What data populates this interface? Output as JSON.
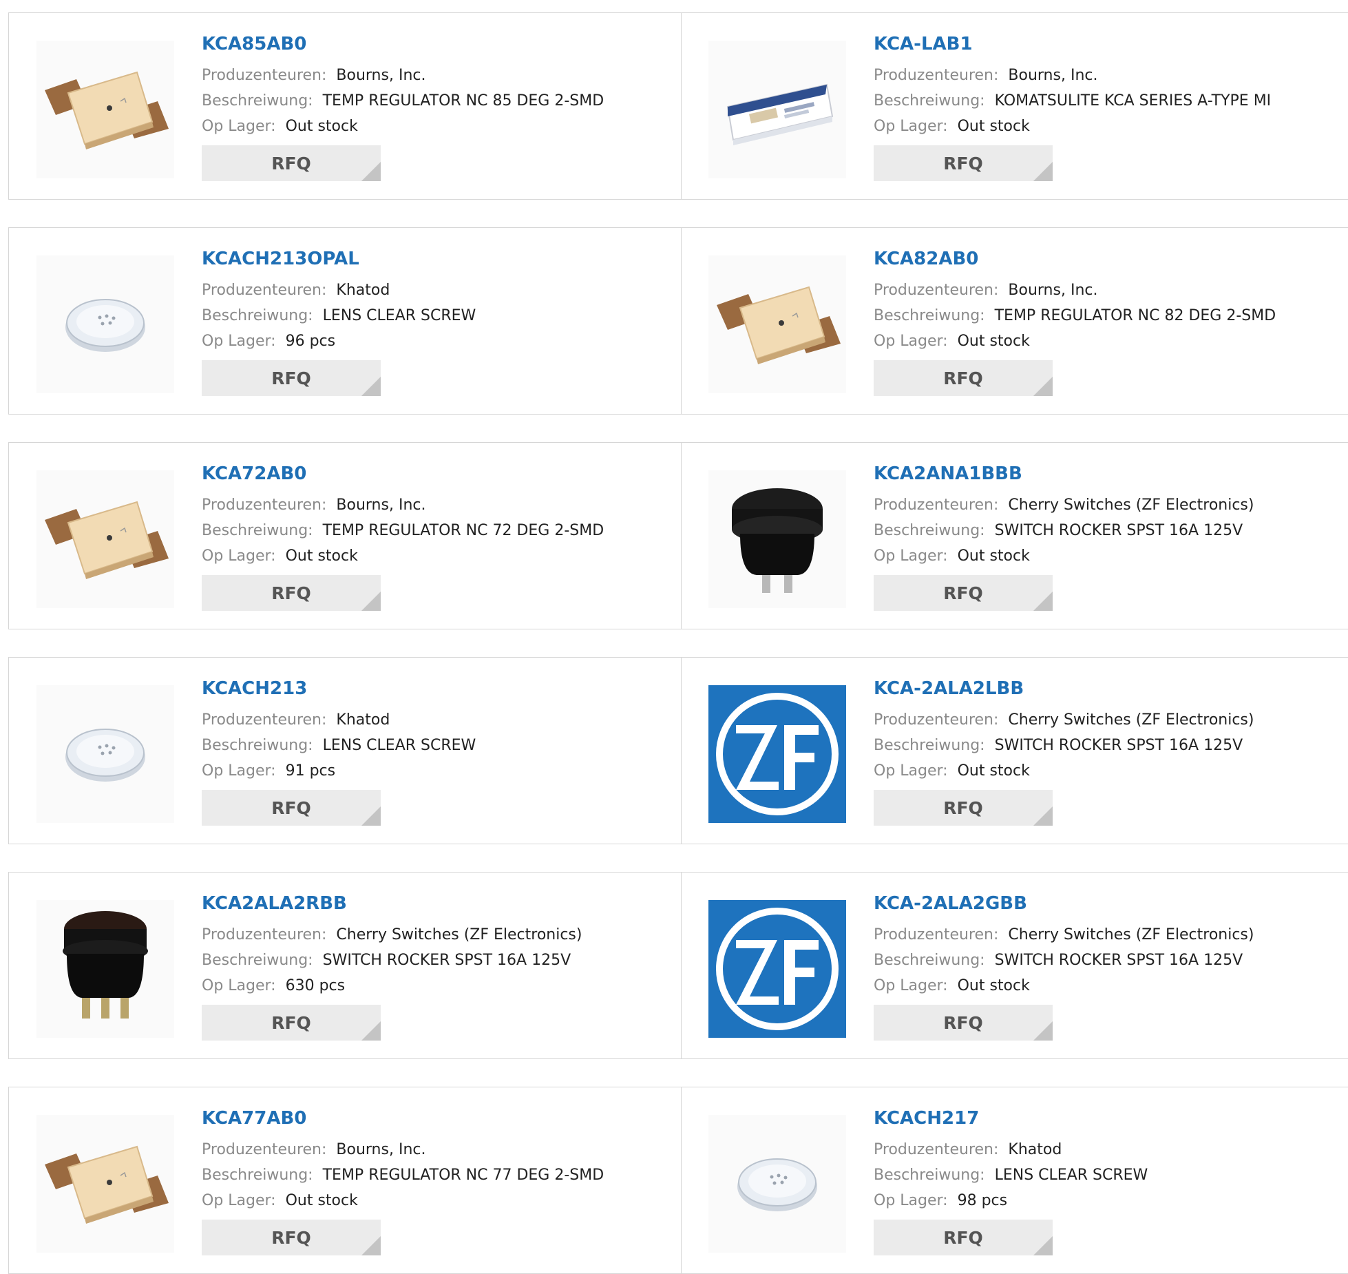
{
  "labels": {
    "manufacturer": "Produzenteuren:",
    "description": "Beschreiwung:",
    "stock": "Op Lager:",
    "rfq": "RFQ"
  },
  "colors": {
    "part_link": "#1f6fb5",
    "label": "#8a8a8a",
    "button_bg": "#ebebeb",
    "zf_blue": "#1e73be"
  },
  "products": [
    {
      "part": "KCA85AB0",
      "manufacturer": "Bourns, Inc.",
      "description": "TEMP REGULATOR NC 85 DEG 2-SMD",
      "stock": "Out stock",
      "image": "temp-regulator-image"
    },
    {
      "part": "KCA-LAB1",
      "manufacturer": "Bourns, Inc.",
      "description": "KOMATSULITE KCA SERIES A-TYPE MI",
      "stock": "Out stock",
      "image": "lab-kit-box-image"
    },
    {
      "part": "KCACH213OPAL",
      "manufacturer": "Khatod",
      "description": "LENS CLEAR SCREW",
      "stock": "96 pcs",
      "image": "lens-image"
    },
    {
      "part": "KCA82AB0",
      "manufacturer": "Bourns, Inc.",
      "description": "TEMP REGULATOR NC 82 DEG 2-SMD",
      "stock": "Out stock",
      "image": "temp-regulator-image"
    },
    {
      "part": "KCA72AB0",
      "manufacturer": "Bourns, Inc.",
      "description": "TEMP REGULATOR NC 72 DEG 2-SMD",
      "stock": "Out stock",
      "image": "temp-regulator-image"
    },
    {
      "part": "KCA2ANA1BBB",
      "manufacturer": "Cherry Switches (ZF Electronics)",
      "description": "SWITCH ROCKER SPST 16A 125V",
      "stock": "Out stock",
      "image": "rocker-switch-image"
    },
    {
      "part": "KCACH213",
      "manufacturer": "Khatod",
      "description": "LENS CLEAR SCREW",
      "stock": "91 pcs",
      "image": "lens-image"
    },
    {
      "part": "KCA-2ALA2LBB",
      "manufacturer": "Cherry Switches (ZF Electronics)",
      "description": "SWITCH ROCKER SPST 16A 125V",
      "stock": "Out stock",
      "image": "zf-logo"
    },
    {
      "part": "KCA2ALA2RBB",
      "manufacturer": "Cherry Switches (ZF Electronics)",
      "description": "SWITCH ROCKER SPST 16A 125V",
      "stock": "630 pcs",
      "image": "rocker-switch-3pin-image"
    },
    {
      "part": "KCA-2ALA2GBB",
      "manufacturer": "Cherry Switches (ZF Electronics)",
      "description": "SWITCH ROCKER SPST 16A 125V",
      "stock": "Out stock",
      "image": "zf-logo"
    },
    {
      "part": "KCA77AB0",
      "manufacturer": "Bourns, Inc.",
      "description": "TEMP REGULATOR NC 77 DEG 2-SMD",
      "stock": "Out stock",
      "image": "temp-regulator-image"
    },
    {
      "part": "KCACH217",
      "manufacturer": "Khatod",
      "description": "LENS CLEAR SCREW",
      "stock": "98 pcs",
      "image": "lens-image"
    }
  ]
}
